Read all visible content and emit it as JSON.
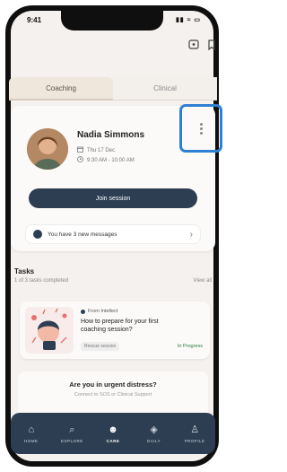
{
  "status": {
    "time": "9:41",
    "system": "▮▮ ≈ ▭"
  },
  "tabs": [
    {
      "label": "Coaching"
    },
    {
      "label": "Clinical"
    }
  ],
  "session": {
    "coach_name": "Nadia Simmons",
    "date": "Thu 17 Dec",
    "time": "9:30 AM - 10:00 AM",
    "join_label": "Join session"
  },
  "messages": {
    "text": "You have 3 new messages"
  },
  "tasks": {
    "title": "Tasks",
    "subtitle": "1 of 3 tasks completed",
    "view_all": "View all",
    "items": [
      {
        "from": "From Intellect",
        "title": "How to prepare for your first coaching session?",
        "type": "Rescue session",
        "status": "In Progress"
      }
    ]
  },
  "urgent": {
    "title": "Are you in urgent distress?",
    "subtitle": "Connect to SOS or Clinical Support"
  },
  "nav": [
    {
      "label": "HOME",
      "icon": "home-icon",
      "glyph": "⌂"
    },
    {
      "label": "EXPLORE",
      "icon": "search-icon",
      "glyph": "⌕"
    },
    {
      "label": "CARE",
      "icon": "care-icon",
      "glyph": "☻"
    },
    {
      "label": "DAILY",
      "icon": "diamond-icon",
      "glyph": "◈"
    },
    {
      "label": "PROFILE",
      "icon": "profile-icon",
      "glyph": "♙"
    }
  ],
  "colors": {
    "primary": "#2d3e53",
    "focus_outline": "#2f7fd3",
    "status_in_progress": "#2a7a3d",
    "background": "#f4f1ee"
  }
}
